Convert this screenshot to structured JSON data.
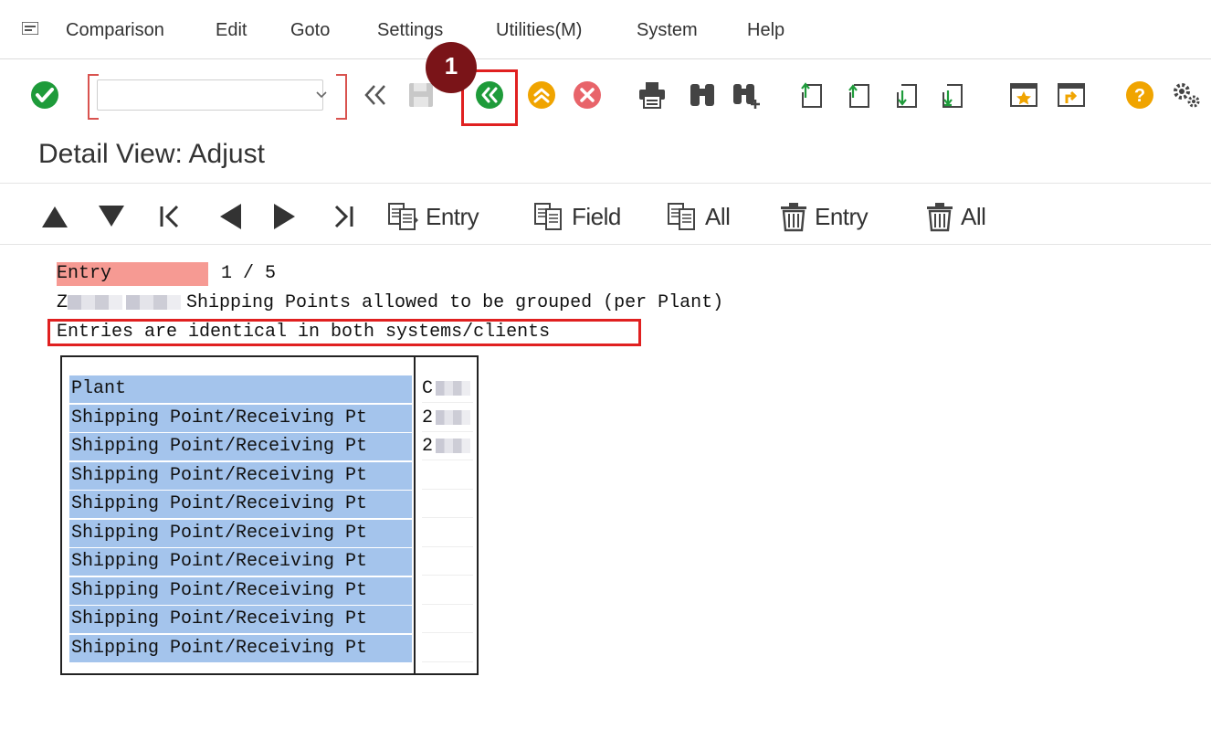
{
  "menu": {
    "items": [
      {
        "label": "Comparison"
      },
      {
        "label": "Edit"
      },
      {
        "label": "Goto"
      },
      {
        "label": "Settings"
      },
      {
        "label": "Utilities(M)"
      },
      {
        "label": "System"
      },
      {
        "label": "Help"
      }
    ]
  },
  "toolbar": {
    "command_value": "",
    "step_badge": "1"
  },
  "page": {
    "title": "Detail View: Adjust"
  },
  "nav": {
    "copy_entry": "Entry",
    "copy_field": "Field",
    "copy_all": "All",
    "delete_entry": "Entry",
    "delete_all": "All"
  },
  "detail": {
    "entry_label": "Entry",
    "entry_count": "1 / 5",
    "table_prefix": "Z",
    "table_desc": "Shipping Points allowed to be grouped (per Plant)",
    "status": "Entries are identical in both systems/clients"
  },
  "comparison": {
    "rows": [
      {
        "label": "Plant",
        "value": "C"
      },
      {
        "label": "Shipping Point/Receiving Pt",
        "value": "2"
      },
      {
        "label": "Shipping Point/Receiving Pt",
        "value": "2"
      },
      {
        "label": "Shipping Point/Receiving Pt",
        "value": ""
      },
      {
        "label": "Shipping Point/Receiving Pt",
        "value": ""
      },
      {
        "label": "Shipping Point/Receiving Pt",
        "value": ""
      },
      {
        "label": "Shipping Point/Receiving Pt",
        "value": ""
      },
      {
        "label": "Shipping Point/Receiving Pt",
        "value": ""
      },
      {
        "label": "Shipping Point/Receiving Pt",
        "value": ""
      },
      {
        "label": "Shipping Point/Receiving Pt",
        "value": ""
      }
    ]
  },
  "colors": {
    "accent_green": "#1e9b3a",
    "accent_orange": "#f0a400",
    "cancel_red": "#e8646a",
    "highlight_red": "#e02020",
    "badge_maroon": "#7a1418",
    "entry_label_bg": "#f69a93",
    "row_label_bg": "#a4c4ec"
  },
  "icons": {
    "toolbar": [
      "check-icon",
      "back-icon",
      "save-icon",
      "exit-icon",
      "up-icon",
      "cancel-icon",
      "print-icon",
      "find-icon",
      "find-next-icon",
      "first-page-icon",
      "previous-page-icon",
      "next-page-icon",
      "last-page-icon",
      "create-session-icon",
      "create-shortcut-icon",
      "help-icon",
      "customize-layout-icon"
    ]
  }
}
